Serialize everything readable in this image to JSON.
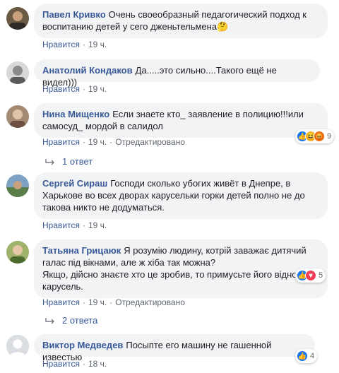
{
  "comments": [
    {
      "author": "Павел Кривко",
      "text": "Очень своеобразный педагогический подход к воспитанию детей у сего дженьтельмена🤔",
      "like": "Нравится",
      "time": "19 ч."
    },
    {
      "author": "Анатолий Кондаков",
      "text": "Да.....это сильно....Такого ещё не видел)))",
      "like": "Нравится",
      "time": "19 ч."
    },
    {
      "author": "Нина Мищенко",
      "text": "Если знаете кто_ заявление в полицию!!!или самосуд_ мордой в салидол",
      "like": "Нравится",
      "time": "19 ч.",
      "edited": "Отредактировано",
      "reactions_count": "9",
      "replies": "1 ответ"
    },
    {
      "author": "Сергей Сираш",
      "text": "Господи сколько убогих живёт в Днепре, в Харькове во всех дворах карусельки горки детей полно не до такова никто не додуматься.",
      "like": "Нравится",
      "time": "19 ч."
    },
    {
      "author": "Татьяна Грицаюк",
      "text_line1": "Я розумію людину, котрій заважає дитячий галас під вікнами, але ж хіба так можна?",
      "text_line2": "Якщо, дійсно знаєте хто це зробив, то примусьте його відновити карусель.",
      "like": "Нравится",
      "time": "19 ч.",
      "edited": "Отредактировано",
      "reactions_count": "5",
      "replies": "2 ответа"
    },
    {
      "author": "Виктор Медведев",
      "text": "Посыпте его машину не гашенной известью",
      "like": "Нравится",
      "time": "18 ч.",
      "reactions_count": "4"
    }
  ],
  "colors": {
    "link": "#385898",
    "bubble": "#f2f3f5",
    "like": "#1877f2",
    "haha": "#f7b125",
    "angry": "#e9710f"
  }
}
